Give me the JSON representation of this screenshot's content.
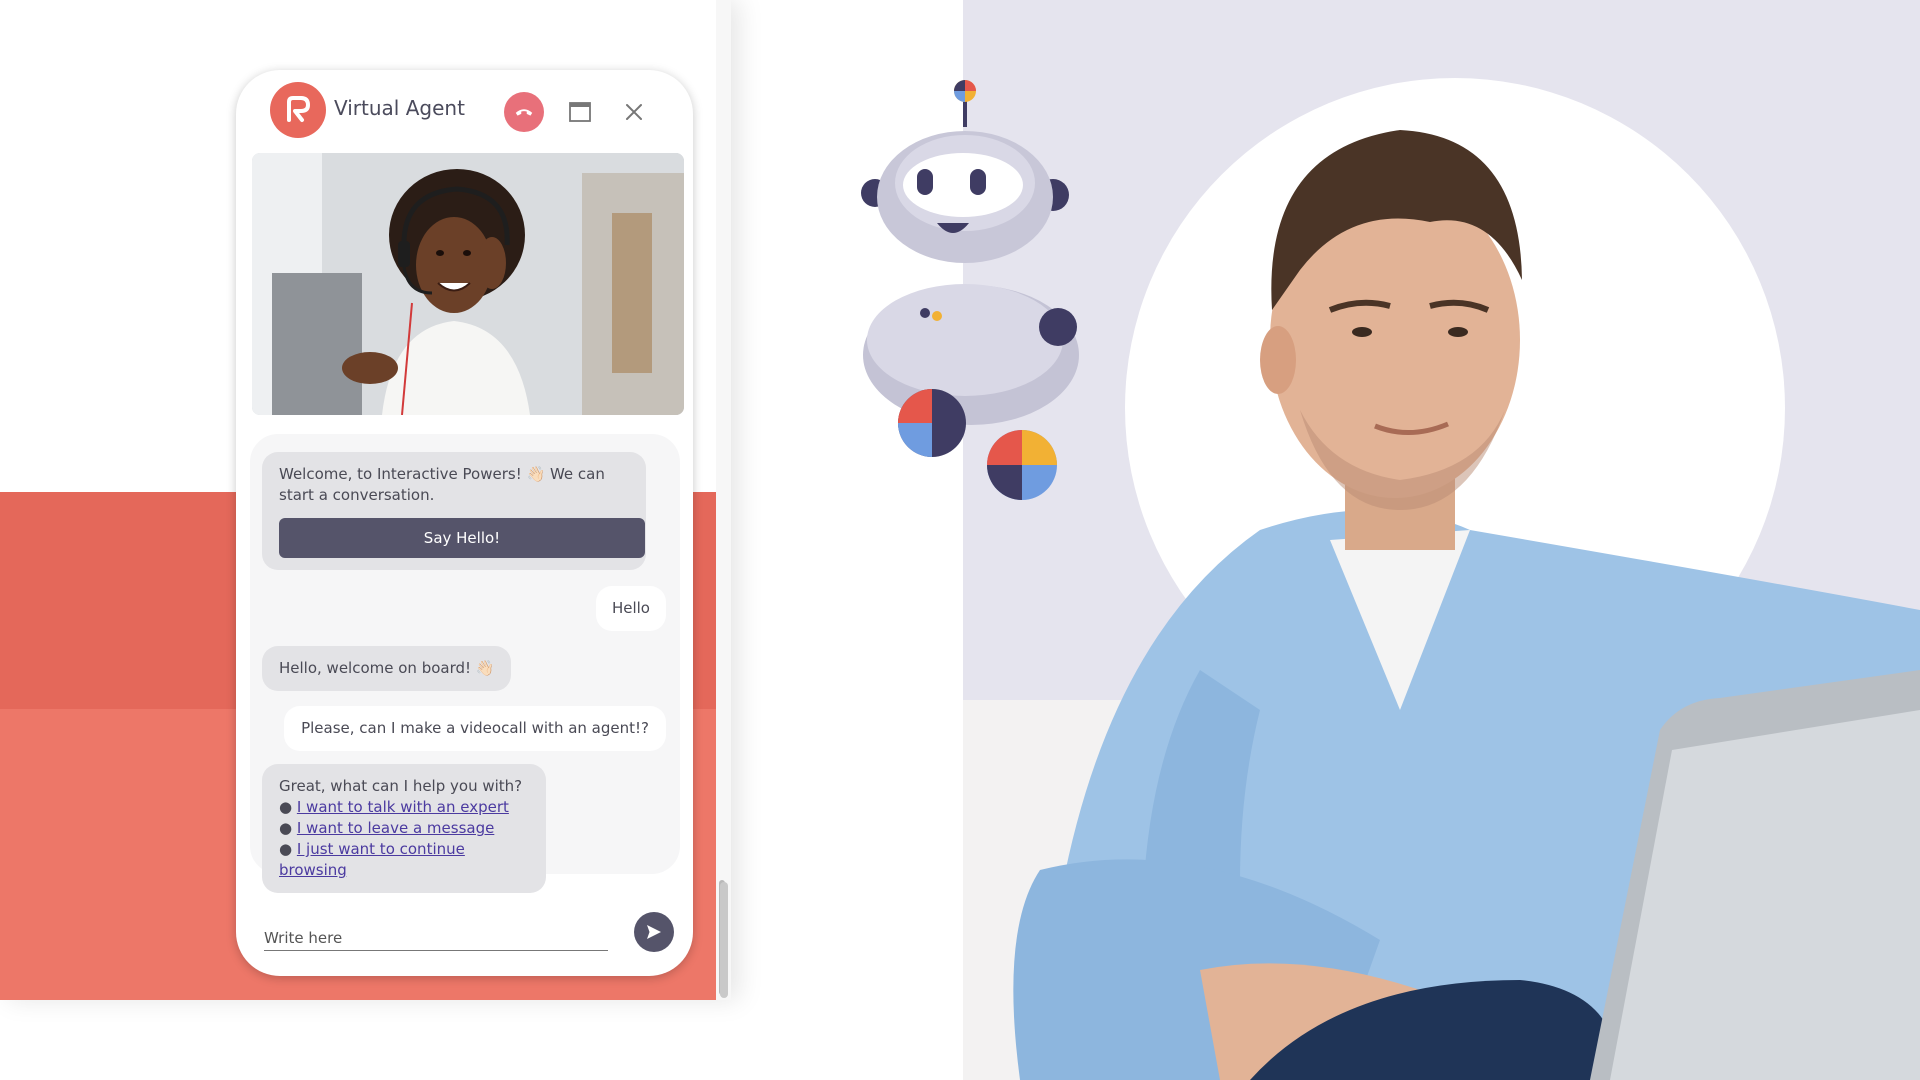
{
  "widget": {
    "title": "Virtual Agent",
    "input_placeholder": "Write here"
  },
  "messages": {
    "welcome": "Welcome, to Interactive Powers! 👋🏻 We can start a conversation.",
    "say_hello_button": "Say Hello!",
    "user_hello": "Hello",
    "bot_welcome_aboard": "Hello, welcome on board! 👋🏻",
    "user_videocall": "Please, can I make a videocall with an agent!?",
    "bot_help": "Great, what can I help you with?",
    "options": [
      "I want to talk with an expert",
      "I want to leave a message",
      "I just want to continue browsing"
    ]
  },
  "icons": {
    "logo": "agent-logo-icon",
    "hangup": "phone-hangup-icon",
    "maximize": "window-maximize-icon",
    "close": "close-icon",
    "send": "send-arrow-icon",
    "bullet": "bullet-icon"
  },
  "colors": {
    "accent": "#e8685c",
    "hangup": "#e8707a",
    "button_dark": "#55546a",
    "link": "#4b3aa0",
    "band_dark": "#e4685a",
    "band_light": "#ed7768",
    "hero_bg": "#e5e4ee"
  }
}
